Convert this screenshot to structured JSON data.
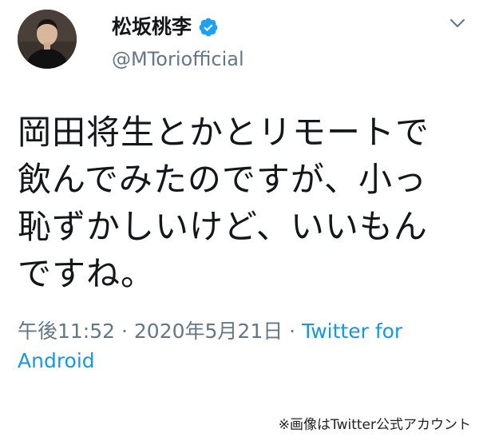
{
  "tweet": {
    "author": {
      "display_name": "松坂桃李",
      "handle": "@MToriofficial",
      "verified": true,
      "avatar_icon": "profile-photo"
    },
    "text": "岡田将生とかとリモートで\n飲んでみたのですが、小っ\n恥ずかしいけど、いいもん\nですね。",
    "timestamp": "午後11:52 · 2020年5月21日 · ",
    "source": "Twitter for Android",
    "menu_icon": "chevron-down-icon"
  },
  "credit": "※画像はTwitter公式アカウント",
  "colors": {
    "verified_blue": "#1da1f2",
    "link_blue": "#1b95e0",
    "muted_gray": "#657786",
    "text_dark": "#14171a"
  }
}
